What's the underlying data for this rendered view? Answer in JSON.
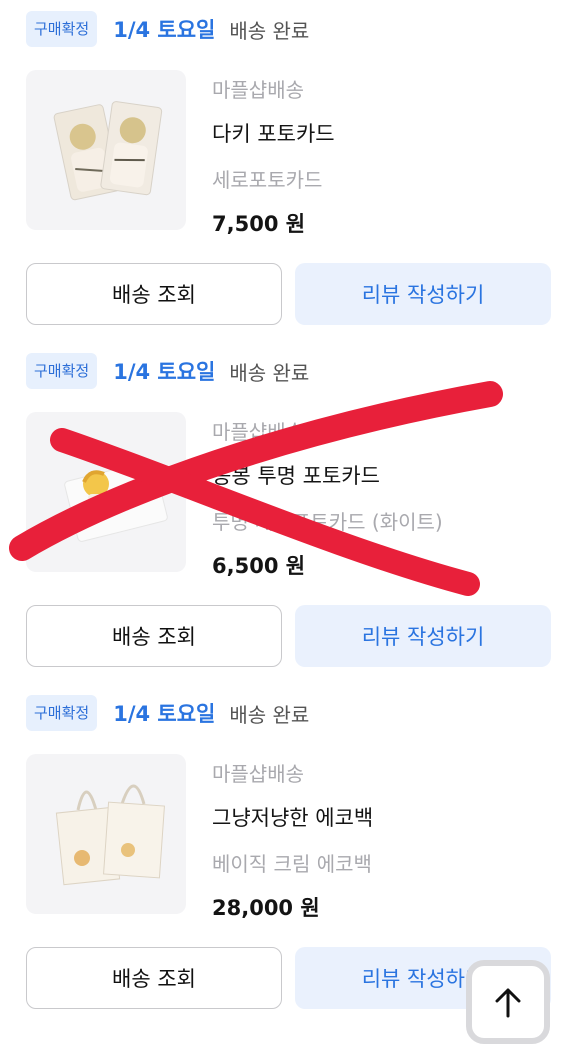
{
  "orders": [
    {
      "badge": "구매확정",
      "date": "1/4 토요일",
      "delivery_status": "배송 완료",
      "seller": "마플샵배송",
      "product_name": "다키 포토카드",
      "option": "세로포토카드",
      "price": "7,500 원",
      "track_label": "배송 조회",
      "review_label": "리뷰 작성하기",
      "thumb_icon": "photocard-image"
    },
    {
      "badge": "구매확정",
      "date": "1/4 토요일",
      "delivery_status": "배송 완료",
      "seller": "마플샵배송",
      "product_name": "동봉 투명 포토카드",
      "option": "투명 세로포토카드 (화이트)",
      "price": "6,500 원",
      "track_label": "배송 조회",
      "review_label": "리뷰 작성하기",
      "thumb_icon": "transparent-photocard-image",
      "crossed_out": true
    },
    {
      "badge": "구매확정",
      "date": "1/4 토요일",
      "delivery_status": "배송 완료",
      "seller": "마플샵배송",
      "product_name": "그냥저냥한 에코백",
      "option": "베이직 크림 에코백",
      "price": "28,000 원",
      "track_label": "배송 조회",
      "review_label": "리뷰 작성하기",
      "thumb_icon": "ecobag-image"
    }
  ],
  "scroll_top_icon": "arrow-up-icon",
  "colors": {
    "accent": "#2a74e0",
    "badge_bg": "#e7f0fd",
    "strike": "#e8203a"
  }
}
